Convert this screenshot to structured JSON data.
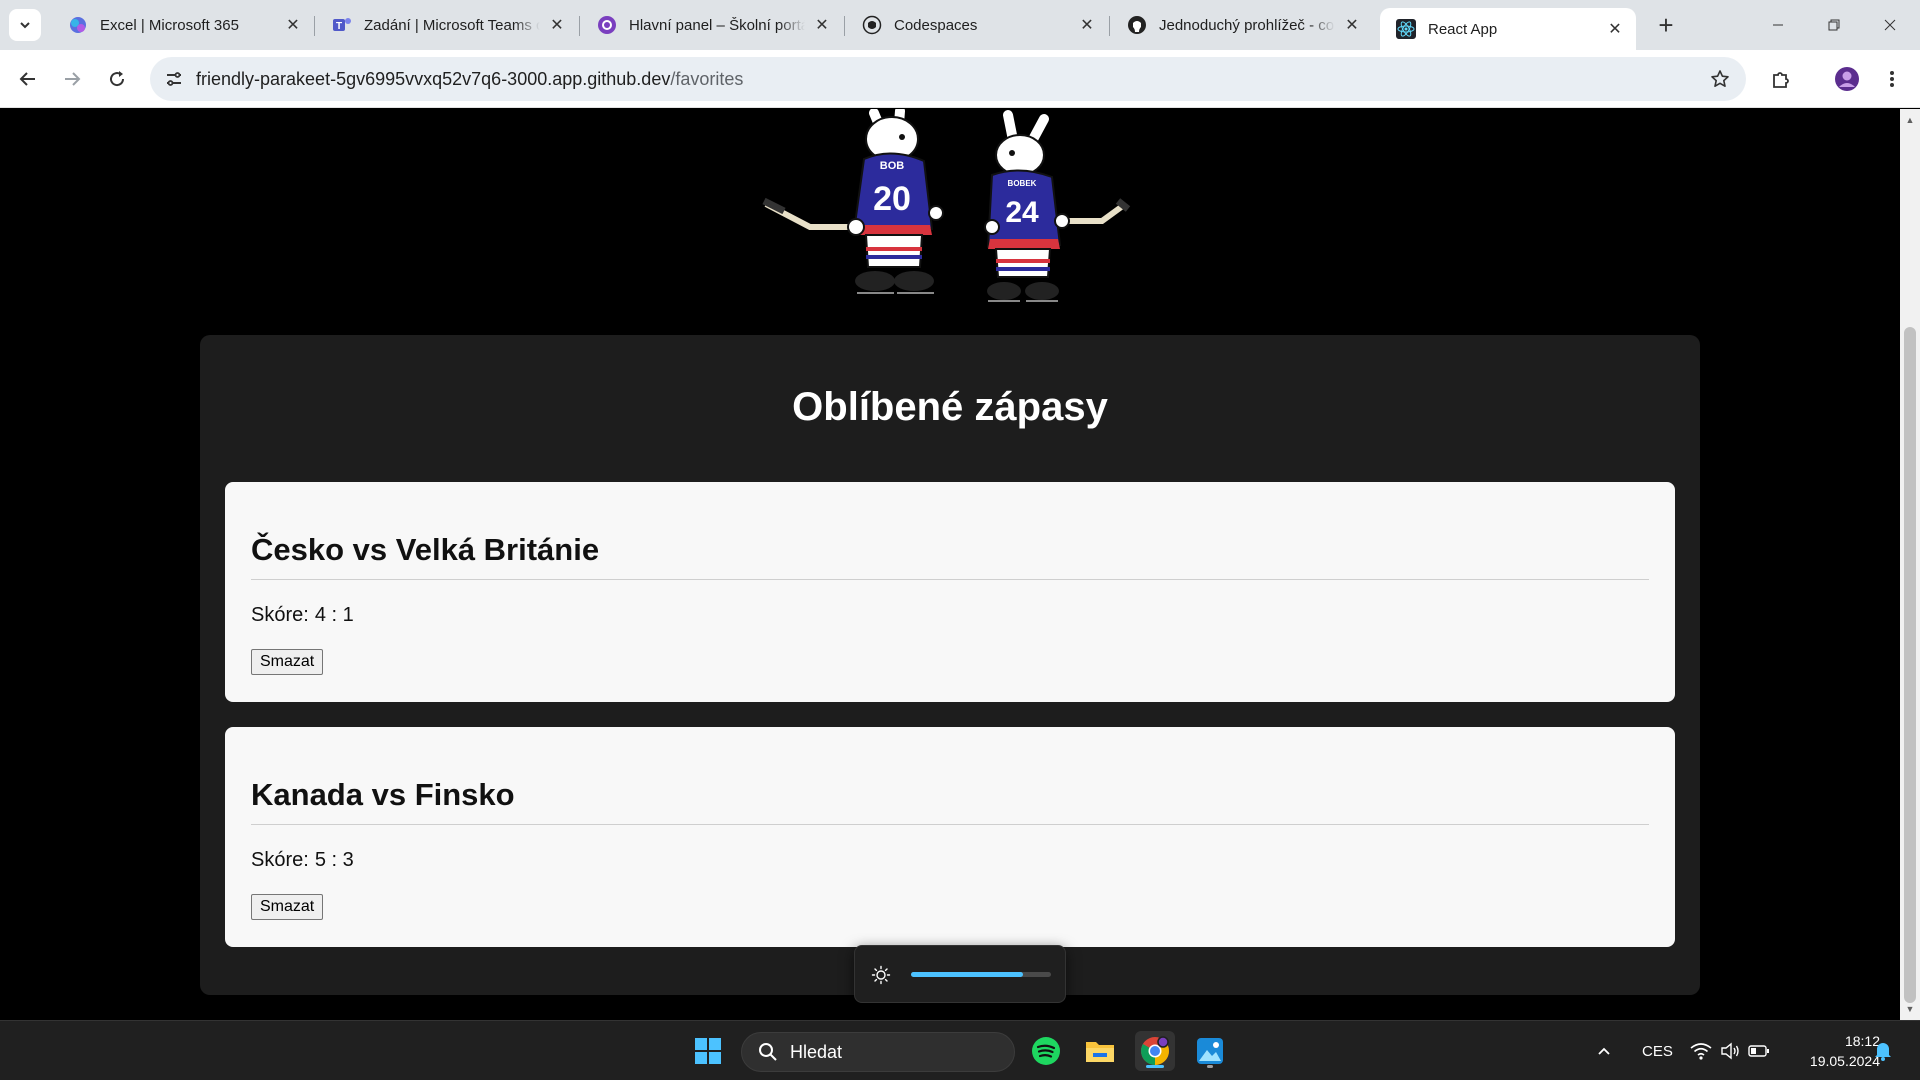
{
  "browser": {
    "tabs": [
      {
        "title": "Excel | Microsoft 365",
        "icon": "m365-icon"
      },
      {
        "title": "Zadání | Microsoft Teams c",
        "icon": "teams-icon"
      },
      {
        "title": "Hlavní panel – Školní portá",
        "icon": "portal-icon"
      },
      {
        "title": "Codespaces",
        "icon": "github-icon"
      },
      {
        "title": "Jednoduchý prohlížeč - co",
        "icon": "github-icon"
      },
      {
        "title": "React App",
        "icon": "react-icon",
        "active": true
      }
    ],
    "url_host": "friendly-parakeet-5gv6995vvxq52v7q6-3000.app.github.dev",
    "url_path": "/favorites"
  },
  "page": {
    "title": "Oblíbené zápasy",
    "mascots": {
      "left_name": "BOB",
      "left_number": "20",
      "right_name": "BOBEK",
      "right_number": "24"
    },
    "favorites": [
      {
        "match": "Česko vs Velká Británie",
        "score_label": "Skóre:",
        "score": "4 : 1",
        "delete_label": "Smazat"
      },
      {
        "match": "Kanada vs Finsko",
        "score_label": "Skóre:",
        "score": "5 : 3",
        "delete_label": "Smazat"
      }
    ]
  },
  "osd": {
    "brightness_percent": 80
  },
  "taskbar": {
    "search_placeholder": "Hledat",
    "language": "CES",
    "time": "18:12",
    "date": "19.05.2024"
  },
  "colors": {
    "accent": "#4cc2ff",
    "page_bg": "#000000",
    "panel_bg": "#1d1d1d",
    "card_bg": "#f8f8f8"
  }
}
